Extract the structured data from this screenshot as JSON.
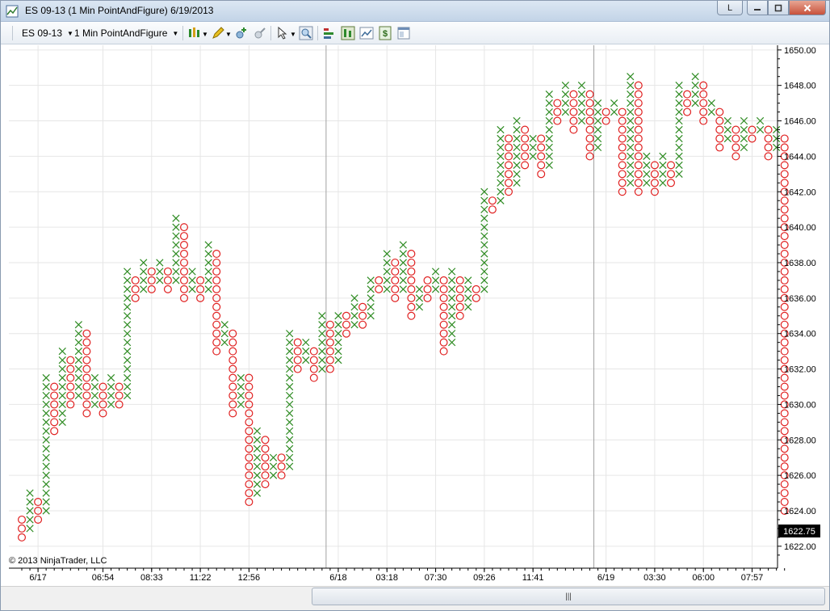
{
  "window": {
    "title": "ES 09-13 (1 Min PointAndFigure)  6/19/2013",
    "link_button": "L",
    "minimize_icon": "minimize-icon",
    "maximize_icon": "maximize-icon",
    "close_icon": "close-icon"
  },
  "toolbar": {
    "instrument": "ES 09-13",
    "period": "1 Min PointAndFigure",
    "icons": [
      "chart-style-icon",
      "pencil-draw-icon",
      "crosshair-icon",
      "global-crosshair-icon",
      "pointer-select-icon",
      "zoom-icon",
      "indicators-icon",
      "strategies-icon",
      "chart-trader-icon",
      "dollar-orders-icon",
      "properties-icon"
    ]
  },
  "chart": {
    "copyright": "© 2013 NinjaTrader, LLC",
    "last_price": "1622.75"
  },
  "colors": {
    "x": "#2e8b22",
    "o": "#e02020",
    "grid": "#e6e6e6",
    "separator": "#a0a0a0"
  },
  "chart_data": {
    "type": "point-and-figure",
    "box_size": 0.5,
    "ylim": [
      1621.5,
      1650.0
    ],
    "y_ticks": [
      "1622.00",
      "1624.00",
      "1626.00",
      "1628.00",
      "1630.00",
      "1632.00",
      "1634.00",
      "1636.00",
      "1638.00",
      "1640.00",
      "1642.00",
      "1644.00",
      "1646.00",
      "1648.00",
      "1650.00"
    ],
    "x_tick_labels": [
      {
        "label": "6/17",
        "col": 2
      },
      {
        "label": "06:54",
        "col": 10
      },
      {
        "label": "08:33",
        "col": 16
      },
      {
        "label": "11:22",
        "col": 22
      },
      {
        "label": "12:56",
        "col": 28
      },
      {
        "label": "6/18",
        "col": 39
      },
      {
        "label": "03:18",
        "col": 45
      },
      {
        "label": "07:30",
        "col": 51
      },
      {
        "label": "09:26",
        "col": 57
      },
      {
        "label": "11:41",
        "col": 63
      },
      {
        "label": "6/19",
        "col": 72
      },
      {
        "label": "03:30",
        "col": 78
      },
      {
        "label": "06:00",
        "col": 84
      },
      {
        "label": "07:57",
        "col": 90
      }
    ],
    "session_breaks": [
      37.5,
      70.5
    ],
    "columns": [
      {
        "t": "O",
        "lo": 1622.5,
        "hi": 1623.5
      },
      {
        "t": "X",
        "lo": 1623.0,
        "hi": 1625.0
      },
      {
        "t": "O",
        "lo": 1623.5,
        "hi": 1624.5
      },
      {
        "t": "X",
        "lo": 1624.0,
        "hi": 1631.5
      },
      {
        "t": "O",
        "lo": 1628.5,
        "hi": 1631.0
      },
      {
        "t": "X",
        "lo": 1629.0,
        "hi": 1633.0
      },
      {
        "t": "O",
        "lo": 1630.0,
        "hi": 1632.5
      },
      {
        "t": "X",
        "lo": 1630.5,
        "hi": 1634.5
      },
      {
        "t": "O",
        "lo": 1629.5,
        "hi": 1634.0
      },
      {
        "t": "X",
        "lo": 1630.0,
        "hi": 1631.5
      },
      {
        "t": "O",
        "lo": 1629.5,
        "hi": 1631.0
      },
      {
        "t": "X",
        "lo": 1630.0,
        "hi": 1631.5
      },
      {
        "t": "O",
        "lo": 1630.0,
        "hi": 1631.0
      },
      {
        "t": "X",
        "lo": 1630.5,
        "hi": 1637.5
      },
      {
        "t": "O",
        "lo": 1636.0,
        "hi": 1637.0
      },
      {
        "t": "X",
        "lo": 1636.5,
        "hi": 1638.0
      },
      {
        "t": "O",
        "lo": 1636.5,
        "hi": 1637.5
      },
      {
        "t": "X",
        "lo": 1637.0,
        "hi": 1638.0
      },
      {
        "t": "O",
        "lo": 1636.5,
        "hi": 1637.5
      },
      {
        "t": "X",
        "lo": 1637.0,
        "hi": 1640.5
      },
      {
        "t": "O",
        "lo": 1636.0,
        "hi": 1640.0
      },
      {
        "t": "X",
        "lo": 1636.5,
        "hi": 1637.5
      },
      {
        "t": "O",
        "lo": 1636.0,
        "hi": 1637.0
      },
      {
        "t": "X",
        "lo": 1636.5,
        "hi": 1639.0
      },
      {
        "t": "O",
        "lo": 1633.0,
        "hi": 1638.5
      },
      {
        "t": "X",
        "lo": 1633.5,
        "hi": 1634.5
      },
      {
        "t": "O",
        "lo": 1629.5,
        "hi": 1634.0
      },
      {
        "t": "X",
        "lo": 1630.0,
        "hi": 1631.5
      },
      {
        "t": "O",
        "lo": 1624.5,
        "hi": 1631.5
      },
      {
        "t": "X",
        "lo": 1625.0,
        "hi": 1628.5
      },
      {
        "t": "O",
        "lo": 1625.5,
        "hi": 1628.0
      },
      {
        "t": "X",
        "lo": 1626.0,
        "hi": 1627.0
      },
      {
        "t": "O",
        "lo": 1626.0,
        "hi": 1627.0
      },
      {
        "t": "X",
        "lo": 1626.5,
        "hi": 1634.0
      },
      {
        "t": "O",
        "lo": 1632.0,
        "hi": 1633.5
      },
      {
        "t": "X",
        "lo": 1632.5,
        "hi": 1633.5
      },
      {
        "t": "O",
        "lo": 1631.5,
        "hi": 1633.0
      },
      {
        "t": "X",
        "lo": 1632.0,
        "hi": 1635.0
      },
      {
        "t": "O",
        "lo": 1632.0,
        "hi": 1634.5
      },
      {
        "t": "X",
        "lo": 1632.5,
        "hi": 1635.0
      },
      {
        "t": "O",
        "lo": 1634.0,
        "hi": 1635.0
      },
      {
        "t": "X",
        "lo": 1634.5,
        "hi": 1636.0
      },
      {
        "t": "O",
        "lo": 1634.5,
        "hi": 1635.5
      },
      {
        "t": "X",
        "lo": 1635.0,
        "hi": 1637.0
      },
      {
        "t": "O",
        "lo": 1636.5,
        "hi": 1637.0
      },
      {
        "t": "X",
        "lo": 1636.5,
        "hi": 1638.5
      },
      {
        "t": "O",
        "lo": 1636.0,
        "hi": 1638.0
      },
      {
        "t": "X",
        "lo": 1636.5,
        "hi": 1639.0
      },
      {
        "t": "O",
        "lo": 1635.0,
        "hi": 1638.5
      },
      {
        "t": "X",
        "lo": 1635.5,
        "hi": 1636.5
      },
      {
        "t": "O",
        "lo": 1636.0,
        "hi": 1637.0
      },
      {
        "t": "X",
        "lo": 1636.5,
        "hi": 1637.5
      },
      {
        "t": "O",
        "lo": 1633.0,
        "hi": 1637.0
      },
      {
        "t": "X",
        "lo": 1633.5,
        "hi": 1637.5
      },
      {
        "t": "O",
        "lo": 1635.0,
        "hi": 1637.0
      },
      {
        "t": "X",
        "lo": 1635.5,
        "hi": 1637.0
      },
      {
        "t": "O",
        "lo": 1636.0,
        "hi": 1636.5
      },
      {
        "t": "X",
        "lo": 1636.5,
        "hi": 1642.0
      },
      {
        "t": "O",
        "lo": 1641.0,
        "hi": 1641.5
      },
      {
        "t": "X",
        "lo": 1641.5,
        "hi": 1645.5
      },
      {
        "t": "O",
        "lo": 1642.0,
        "hi": 1645.0
      },
      {
        "t": "X",
        "lo": 1642.5,
        "hi": 1646.0
      },
      {
        "t": "O",
        "lo": 1643.5,
        "hi": 1645.5
      },
      {
        "t": "X",
        "lo": 1644.0,
        "hi": 1645.0
      },
      {
        "t": "O",
        "lo": 1643.0,
        "hi": 1645.0
      },
      {
        "t": "X",
        "lo": 1643.5,
        "hi": 1647.5
      },
      {
        "t": "O",
        "lo": 1646.0,
        "hi": 1647.0
      },
      {
        "t": "X",
        "lo": 1646.5,
        "hi": 1648.0
      },
      {
        "t": "O",
        "lo": 1645.5,
        "hi": 1647.5
      },
      {
        "t": "X",
        "lo": 1646.0,
        "hi": 1648.0
      },
      {
        "t": "O",
        "lo": 1644.0,
        "hi": 1647.5
      },
      {
        "t": "X",
        "lo": 1644.5,
        "hi": 1647.0
      },
      {
        "t": "O",
        "lo": 1646.0,
        "hi": 1646.5
      },
      {
        "t": "X",
        "lo": 1646.5,
        "hi": 1647.0
      },
      {
        "t": "O",
        "lo": 1642.0,
        "hi": 1646.5
      },
      {
        "t": "X",
        "lo": 1642.5,
        "hi": 1648.5
      },
      {
        "t": "O",
        "lo": 1642.0,
        "hi": 1648.0
      },
      {
        "t": "X",
        "lo": 1642.5,
        "hi": 1644.0
      },
      {
        "t": "O",
        "lo": 1642.0,
        "hi": 1643.5
      },
      {
        "t": "X",
        "lo": 1642.5,
        "hi": 1644.0
      },
      {
        "t": "O",
        "lo": 1642.5,
        "hi": 1643.5
      },
      {
        "t": "X",
        "lo": 1643.0,
        "hi": 1648.0
      },
      {
        "t": "O",
        "lo": 1646.5,
        "hi": 1647.5
      },
      {
        "t": "X",
        "lo": 1647.0,
        "hi": 1648.5
      },
      {
        "t": "O",
        "lo": 1646.0,
        "hi": 1648.0
      },
      {
        "t": "X",
        "lo": 1646.5,
        "hi": 1647.0
      },
      {
        "t": "O",
        "lo": 1644.5,
        "hi": 1646.5
      },
      {
        "t": "X",
        "lo": 1645.0,
        "hi": 1646.0
      },
      {
        "t": "O",
        "lo": 1644.0,
        "hi": 1645.5
      },
      {
        "t": "X",
        "lo": 1644.5,
        "hi": 1646.0
      },
      {
        "t": "O",
        "lo": 1645.0,
        "hi": 1645.5
      },
      {
        "t": "X",
        "lo": 1645.5,
        "hi": 1646.0
      },
      {
        "t": "O",
        "lo": 1644.0,
        "hi": 1645.5
      },
      {
        "t": "X",
        "lo": 1644.5,
        "hi": 1645.5
      },
      {
        "t": "O",
        "lo": 1624.0,
        "hi": 1645.0
      }
    ]
  }
}
